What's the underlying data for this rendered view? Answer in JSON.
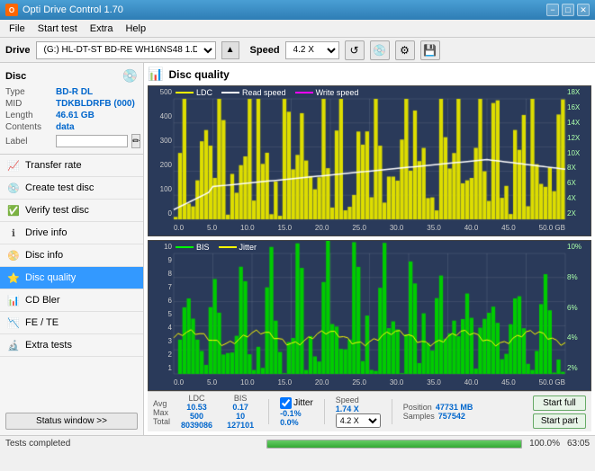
{
  "titleBar": {
    "title": "Opti Drive Control 1.70",
    "minimize": "−",
    "maximize": "□",
    "close": "✕"
  },
  "menuBar": {
    "items": [
      "File",
      "Start test",
      "Extra",
      "Help"
    ]
  },
  "driveBar": {
    "driveLabel": "Drive",
    "driveValue": "(G:)  HL-DT-ST BD-RE  WH16NS48 1.D3",
    "speedLabel": "Speed",
    "speedValue": "4.2 X"
  },
  "discInfo": {
    "title": "Disc",
    "typeLabel": "Type",
    "typeValue": "BD-R DL",
    "midLabel": "MID",
    "midValue": "TDKBLDRFB (000)",
    "lengthLabel": "Length",
    "lengthValue": "46.61 GB",
    "contentsLabel": "Contents",
    "contentsValue": "data",
    "labelLabel": "Label"
  },
  "navItems": [
    {
      "id": "transfer-rate",
      "label": "Transfer rate",
      "icon": "📈"
    },
    {
      "id": "create-test-disc",
      "label": "Create test disc",
      "icon": "💿"
    },
    {
      "id": "verify-test-disc",
      "label": "Verify test disc",
      "icon": "✅"
    },
    {
      "id": "drive-info",
      "label": "Drive info",
      "icon": "ℹ"
    },
    {
      "id": "disc-info",
      "label": "Disc info",
      "icon": "📀"
    },
    {
      "id": "disc-quality",
      "label": "Disc quality",
      "icon": "⭐",
      "active": true
    },
    {
      "id": "cd-bler",
      "label": "CD Bler",
      "icon": "📊"
    },
    {
      "id": "fe-te",
      "label": "FE / TE",
      "icon": "📉"
    },
    {
      "id": "extra-tests",
      "label": "Extra tests",
      "icon": "🔬"
    }
  ],
  "statusBtn": "Status window >>",
  "chart": {
    "title": "Disc quality",
    "legend1": [
      {
        "label": "LDC",
        "color": "#ffff00"
      },
      {
        "label": "Read speed",
        "color": "#ffffff"
      },
      {
        "label": "Write speed",
        "color": "#ff00ff"
      }
    ],
    "legend2": [
      {
        "label": "BIS",
        "color": "#00ff00"
      },
      {
        "label": "Jitter",
        "color": "#ffff00"
      }
    ],
    "yLeft1": [
      "500",
      "400",
      "300",
      "200",
      "100",
      "0"
    ],
    "yRight1": [
      "18X",
      "16X",
      "14X",
      "12X",
      "10X",
      "8X",
      "6X",
      "4X",
      "2X"
    ],
    "yLeft2": [
      "10",
      "9",
      "8",
      "7",
      "6",
      "5",
      "4",
      "3",
      "2",
      "1"
    ],
    "yRight2": [
      "10%",
      "8%",
      "6%",
      "4%",
      "2%"
    ],
    "xAxis": [
      "0.0",
      "5.0",
      "10.0",
      "15.0",
      "20.0",
      "25.0",
      "30.0",
      "35.0",
      "40.0",
      "45.0",
      "50.0 GB"
    ]
  },
  "stats": {
    "headers": [
      "",
      "LDC",
      "BIS",
      "",
      "Jitter",
      "Speed",
      "",
      ""
    ],
    "avgLabel": "Avg",
    "avgLDC": "10.53",
    "avgBIS": "0.17",
    "avgJitter": "-0.1%",
    "maxLabel": "Max",
    "maxLDC": "500",
    "maxBIS": "10",
    "maxJitter": "0.0%",
    "totalLabel": "Total",
    "totalLDC": "8039086",
    "totalBIS": "127101",
    "speedValue": "1.74 X",
    "speedSelect": "4.2 X",
    "positionLabel": "Position",
    "positionValue": "47731 MB",
    "samplesLabel": "Samples",
    "samplesValue": "757542",
    "startFullBtn": "Start full",
    "startPartBtn": "Start part",
    "jitterLabel": "Jitter",
    "jitterChecked": true
  },
  "progressBar": {
    "statusText": "Tests completed",
    "percentage": "100.0%",
    "widthPercent": 100,
    "timeValue": "63:05"
  }
}
